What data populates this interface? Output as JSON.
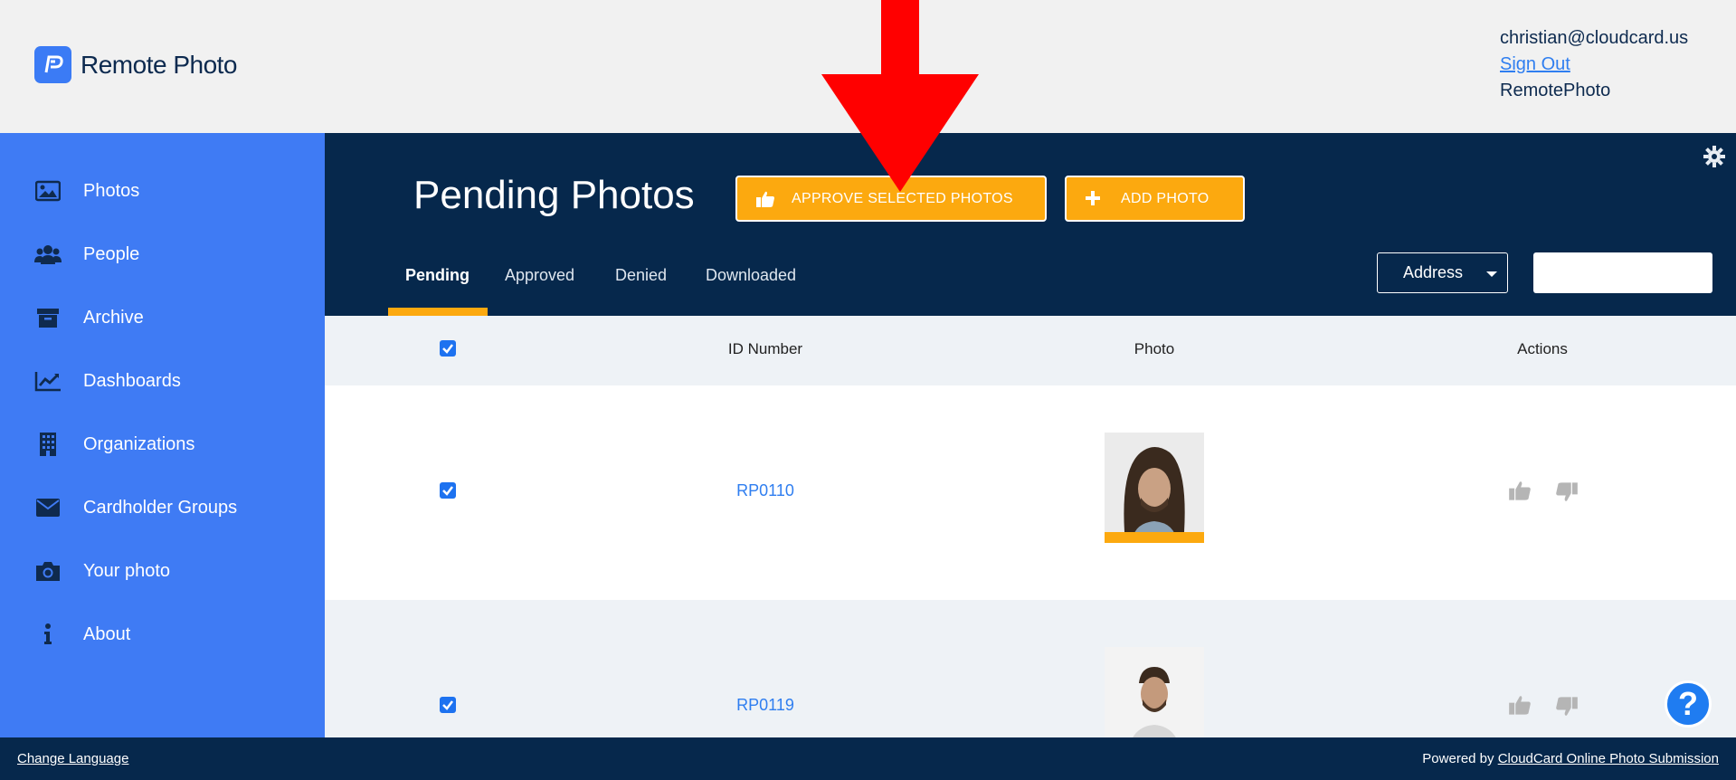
{
  "header": {
    "brand": "Remote Photo",
    "user_email": "christian@cloudcard.us",
    "sign_out": "Sign Out",
    "organization": "RemotePhoto"
  },
  "sidebar": {
    "items": [
      {
        "label": "Photos",
        "icon": "image-icon"
      },
      {
        "label": "People",
        "icon": "users-icon"
      },
      {
        "label": "Archive",
        "icon": "archive-icon"
      },
      {
        "label": "Dashboards",
        "icon": "chart-line-icon"
      },
      {
        "label": "Organizations",
        "icon": "building-icon"
      },
      {
        "label": "Cardholder Groups",
        "icon": "envelope-icon"
      },
      {
        "label": "Your photo",
        "icon": "camera-icon"
      },
      {
        "label": "About",
        "icon": "info-icon"
      }
    ]
  },
  "main": {
    "title": "Pending Photos",
    "approve_button": "APPROVE SELECTED PHOTOS",
    "add_button": "ADD PHOTO",
    "tabs": [
      {
        "label": "Pending",
        "active": true
      },
      {
        "label": "Approved",
        "active": false
      },
      {
        "label": "Denied",
        "active": false
      },
      {
        "label": "Downloaded",
        "active": false
      }
    ],
    "filter_select": "Address",
    "search_value": ""
  },
  "table": {
    "columns": [
      "ID Number",
      "Photo",
      "Actions"
    ],
    "rows": [
      {
        "id": "RP0110",
        "checked": true
      },
      {
        "id": "RP0119",
        "checked": true
      }
    ]
  },
  "footer": {
    "change_language": "Change Language",
    "powered_by": "Powered by",
    "powered_link": "CloudCard Online Photo Submission"
  },
  "colors": {
    "brand_blue": "#3f7bf4",
    "navy": "#06284c",
    "accent_orange": "#fca90f",
    "link_blue": "#2f7ef0",
    "annotation_red": "#ff0000"
  },
  "help_icon": "?"
}
